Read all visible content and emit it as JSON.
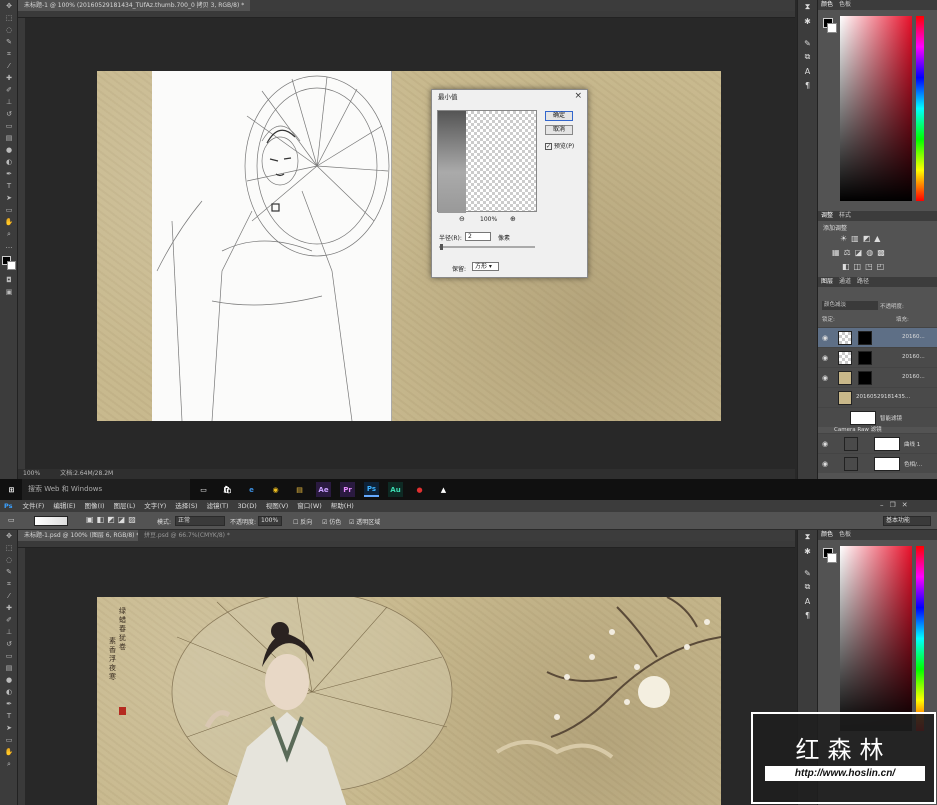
{
  "top_window": {
    "doc_tab": "未标题-1 @ 100% (20160529181434_TUfAz.thumb.700_0 拷贝 3, RGB/8) *",
    "status_zoom": "100%",
    "status_doc": "文档:2.64M/28.2M",
    "dialog": {
      "title": "最小值",
      "ok": "确定",
      "cancel": "取消",
      "preview_label": "预览(P)",
      "zoom": "100%",
      "radius_label": "半径(R):",
      "radius_value": "2",
      "unit": "像素",
      "preserve_label": "保留:",
      "preserve_value": "方形"
    },
    "panels": {
      "color_tabs": [
        "颜色",
        "色板"
      ],
      "adjust_tabs": [
        "调整",
        "样式"
      ],
      "adjust_add": "添加调整",
      "layers_tabs": [
        "图层",
        "通道",
        "路径"
      ],
      "blend_mode": "颜色减淡",
      "opacity_label": "不透明度:",
      "lock_label": "锁定:",
      "fill_label": "填充:",
      "layers": [
        {
          "name": "20160...",
          "selected": true
        },
        {
          "name": "20160...",
          "selected": false
        },
        {
          "name": "20160...",
          "selected": false
        },
        {
          "name": "20160529181435...",
          "selected": false
        },
        {
          "name": "智能滤镜",
          "selected": false
        },
        {
          "name": "Camera Raw 滤镜",
          "selected": false
        },
        {
          "name": "曲线 1",
          "selected": false
        },
        {
          "name": "色相/...",
          "selected": false
        }
      ]
    }
  },
  "taskbar": {
    "search_text": "搜索 Web 和 Windows",
    "apps": [
      "Ae",
      "Pr",
      "Ps",
      "Au"
    ]
  },
  "bottom_window": {
    "app_logo": "Ps",
    "menu": [
      "文件(F)",
      "编辑(E)",
      "图像(I)",
      "图层(L)",
      "文字(Y)",
      "选择(S)",
      "滤镜(T)",
      "3D(D)",
      "视图(V)",
      "窗口(W)",
      "帮助(H)"
    ],
    "options": {
      "mode_label": "模式:",
      "mode_value": "正常",
      "opacity_label": "不透明度:",
      "opacity_value": "100%",
      "reverse": "反向",
      "dither": "仿色",
      "transparency": "透明区域",
      "workspace": "基本功能"
    },
    "doc_tabs": [
      "未标题-1.psd @ 100% (图层 6, RGB/8) *",
      "拼豆.psd @ 66.7%(CMYK/8) *"
    ],
    "poem_col1": "绿蜡春犹卷",
    "poem_col2": "素香浮夜寒"
  },
  "watermark": {
    "title": "红森林",
    "url": "http://www.hoslin.cn/"
  }
}
